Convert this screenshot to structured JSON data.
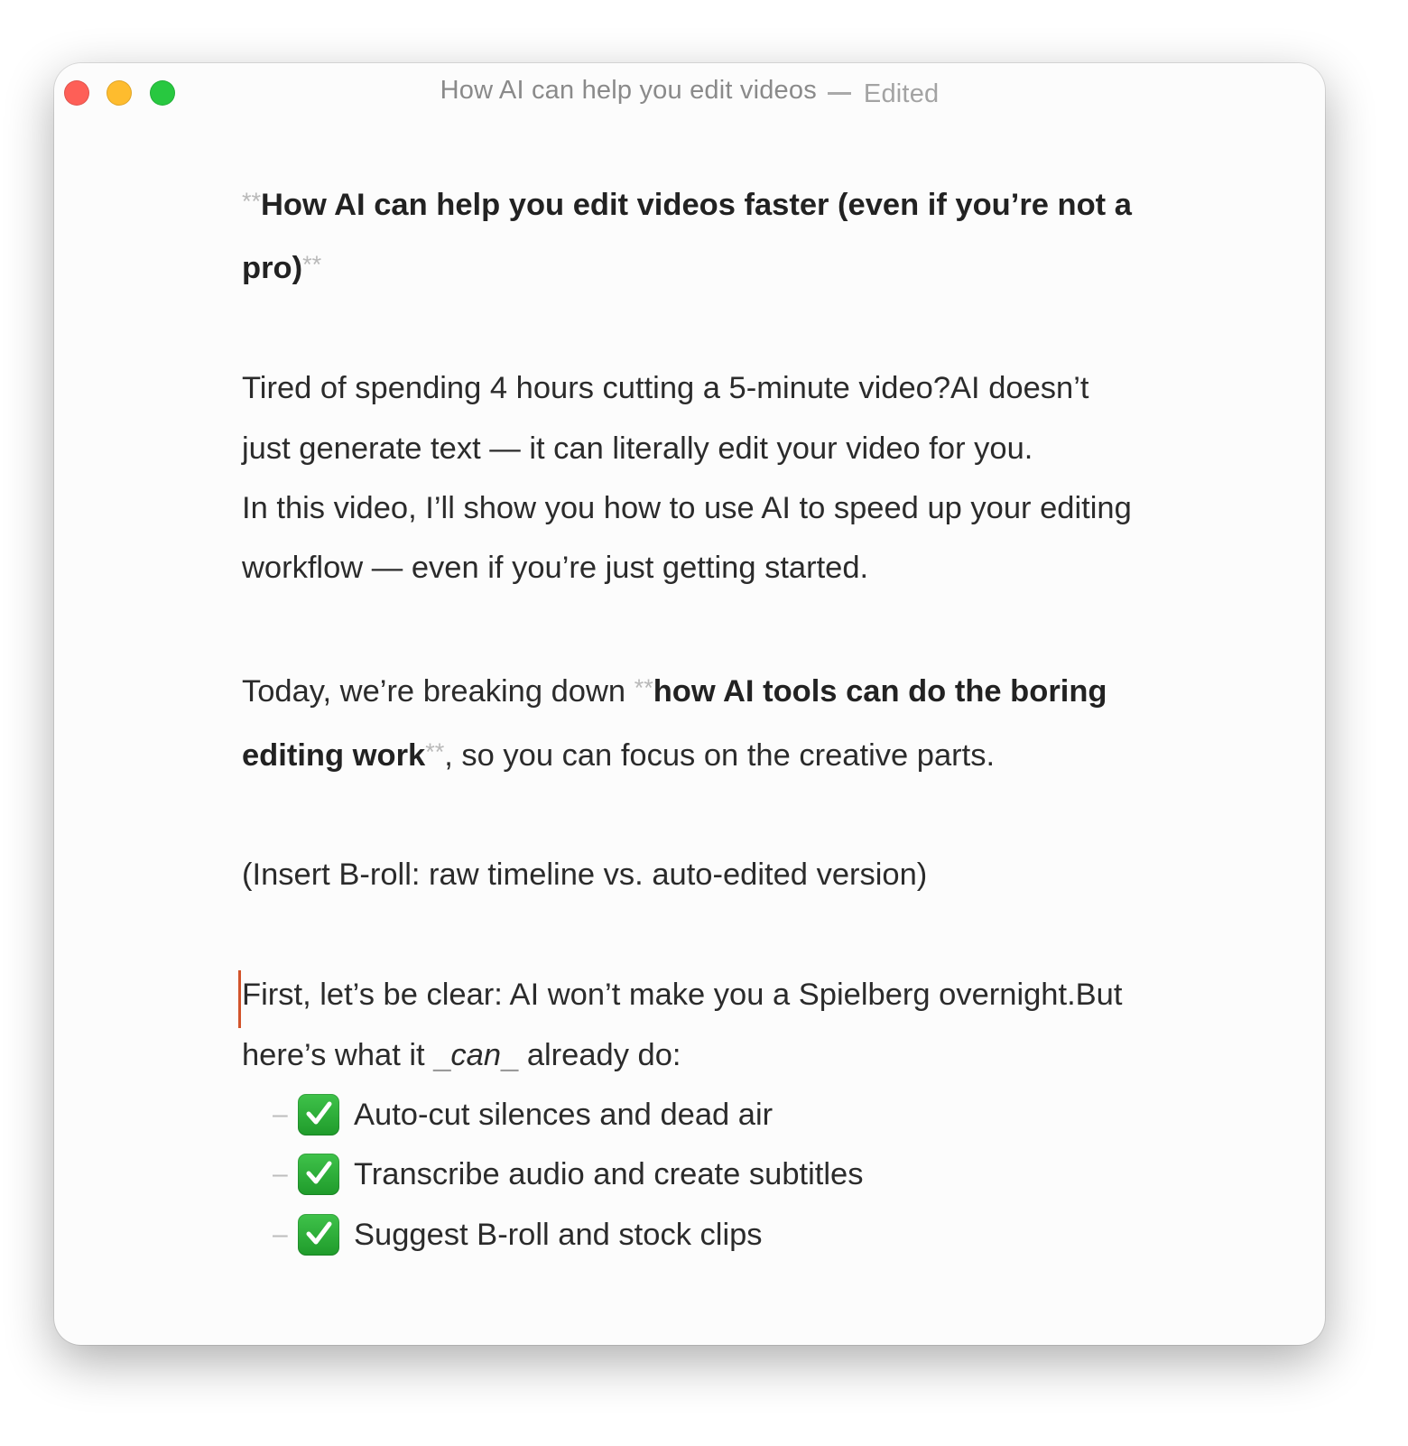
{
  "window": {
    "title": "How AI can help you edit videos",
    "status": "Edited"
  },
  "document": {
    "heading": {
      "marker_open": "**",
      "text": "How AI can help you edit videos faster (even if you’re not a pro)",
      "marker_close": "**"
    },
    "para1": "Tired of spending 4 hours cutting a 5-minute video?AI doesn’t just generate text — it can literally edit your video for you.",
    "para2": "In this video, I’ll show you how to use AI to speed up your editing workflow — even if you’re just getting started.",
    "para3": {
      "before": "Today, we’re breaking down ",
      "marker_open": "**",
      "bold": "how AI tools can do the boring editing work",
      "marker_close": "**",
      "after": ", so you can focus on the creative parts."
    },
    "para4": "(Insert B-roll: raw timeline vs. auto-edited version)",
    "para5": {
      "line1": "First, let’s be clear: AI won’t make you a Spielberg overnight.But here’s what it ",
      "italic_open": "_",
      "italic": "can",
      "italic_close": "_",
      "after": " already do:"
    },
    "list": [
      {
        "bullet": "–",
        "icon": "check-mark-button-icon",
        "text": "Auto-cut silences and dead air"
      },
      {
        "bullet": "–",
        "icon": "check-mark-button-icon",
        "text": "Transcribe audio and create subtitles"
      },
      {
        "bullet": "–",
        "icon": "check-mark-button-icon",
        "text": "Suggest B-roll and stock clips"
      }
    ]
  },
  "colors": {
    "close": "#fe5f57",
    "minimize": "#febc2e",
    "maximize": "#28c840",
    "caret": "#d2542b",
    "check": "#2bb33a"
  }
}
